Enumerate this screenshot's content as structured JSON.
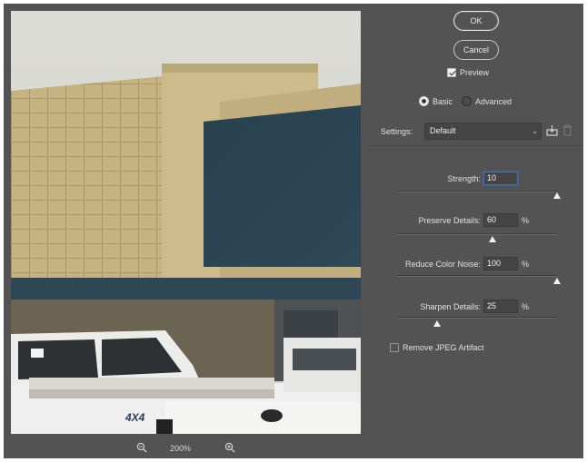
{
  "buttons": {
    "ok": "OK",
    "cancel": "Cancel"
  },
  "preview_checkbox": {
    "label": "Preview",
    "checked": true
  },
  "mode": {
    "basic": "Basic",
    "advanced": "Advanced",
    "selected": "Basic"
  },
  "settings": {
    "label": "Settings:",
    "value": "Default"
  },
  "params": {
    "strength": {
      "label": "Strength:",
      "value": "10",
      "max": 10,
      "unit": ""
    },
    "preserve_details": {
      "label": "Preserve Details:",
      "value": "60",
      "max": 100,
      "unit": "%"
    },
    "reduce_color_noise": {
      "label": "Reduce Color Noise:",
      "value": "100",
      "max": 100,
      "unit": "%"
    },
    "sharpen_details": {
      "label": "Sharpen Details:",
      "value": "25",
      "max": 100,
      "unit": "%"
    }
  },
  "remove_jpeg_artifact": {
    "label": "Remove JPEG Artifact",
    "checked": false
  },
  "zoom": {
    "level": "200%"
  },
  "icons": {
    "zoom_out": "zoom-out-icon",
    "zoom_in": "zoom-in-icon",
    "save": "save-preset-icon",
    "delete": "delete-preset-icon"
  },
  "colors": {
    "panel_bg": "#535353",
    "field_bg": "#454545",
    "focus_ring": "#3d5f94"
  }
}
